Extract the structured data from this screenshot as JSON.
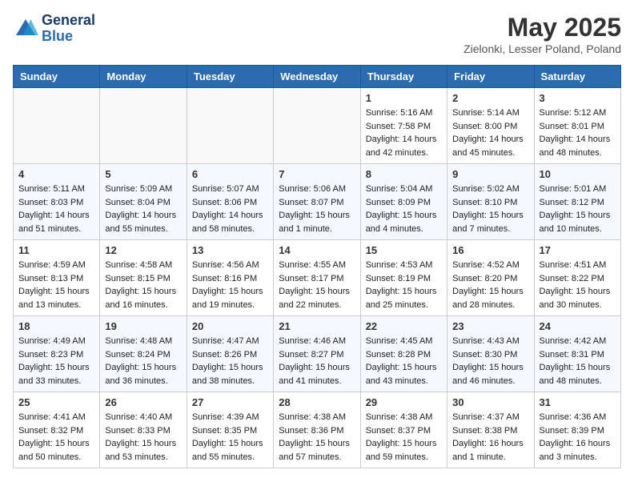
{
  "header": {
    "logo_line1": "General",
    "logo_line2": "Blue",
    "month": "May 2025",
    "location": "Zielonki, Lesser Poland, Poland"
  },
  "weekdays": [
    "Sunday",
    "Monday",
    "Tuesday",
    "Wednesday",
    "Thursday",
    "Friday",
    "Saturday"
  ],
  "weeks": [
    [
      {
        "day": "",
        "info": ""
      },
      {
        "day": "",
        "info": ""
      },
      {
        "day": "",
        "info": ""
      },
      {
        "day": "",
        "info": ""
      },
      {
        "day": "1",
        "info": "Sunrise: 5:16 AM\nSunset: 7:58 PM\nDaylight: 14 hours\nand 42 minutes."
      },
      {
        "day": "2",
        "info": "Sunrise: 5:14 AM\nSunset: 8:00 PM\nDaylight: 14 hours\nand 45 minutes."
      },
      {
        "day": "3",
        "info": "Sunrise: 5:12 AM\nSunset: 8:01 PM\nDaylight: 14 hours\nand 48 minutes."
      }
    ],
    [
      {
        "day": "4",
        "info": "Sunrise: 5:11 AM\nSunset: 8:03 PM\nDaylight: 14 hours\nand 51 minutes."
      },
      {
        "day": "5",
        "info": "Sunrise: 5:09 AM\nSunset: 8:04 PM\nDaylight: 14 hours\nand 55 minutes."
      },
      {
        "day": "6",
        "info": "Sunrise: 5:07 AM\nSunset: 8:06 PM\nDaylight: 14 hours\nand 58 minutes."
      },
      {
        "day": "7",
        "info": "Sunrise: 5:06 AM\nSunset: 8:07 PM\nDaylight: 15 hours\nand 1 minute."
      },
      {
        "day": "8",
        "info": "Sunrise: 5:04 AM\nSunset: 8:09 PM\nDaylight: 15 hours\nand 4 minutes."
      },
      {
        "day": "9",
        "info": "Sunrise: 5:02 AM\nSunset: 8:10 PM\nDaylight: 15 hours\nand 7 minutes."
      },
      {
        "day": "10",
        "info": "Sunrise: 5:01 AM\nSunset: 8:12 PM\nDaylight: 15 hours\nand 10 minutes."
      }
    ],
    [
      {
        "day": "11",
        "info": "Sunrise: 4:59 AM\nSunset: 8:13 PM\nDaylight: 15 hours\nand 13 minutes."
      },
      {
        "day": "12",
        "info": "Sunrise: 4:58 AM\nSunset: 8:15 PM\nDaylight: 15 hours\nand 16 minutes."
      },
      {
        "day": "13",
        "info": "Sunrise: 4:56 AM\nSunset: 8:16 PM\nDaylight: 15 hours\nand 19 minutes."
      },
      {
        "day": "14",
        "info": "Sunrise: 4:55 AM\nSunset: 8:17 PM\nDaylight: 15 hours\nand 22 minutes."
      },
      {
        "day": "15",
        "info": "Sunrise: 4:53 AM\nSunset: 8:19 PM\nDaylight: 15 hours\nand 25 minutes."
      },
      {
        "day": "16",
        "info": "Sunrise: 4:52 AM\nSunset: 8:20 PM\nDaylight: 15 hours\nand 28 minutes."
      },
      {
        "day": "17",
        "info": "Sunrise: 4:51 AM\nSunset: 8:22 PM\nDaylight: 15 hours\nand 30 minutes."
      }
    ],
    [
      {
        "day": "18",
        "info": "Sunrise: 4:49 AM\nSunset: 8:23 PM\nDaylight: 15 hours\nand 33 minutes."
      },
      {
        "day": "19",
        "info": "Sunrise: 4:48 AM\nSunset: 8:24 PM\nDaylight: 15 hours\nand 36 minutes."
      },
      {
        "day": "20",
        "info": "Sunrise: 4:47 AM\nSunset: 8:26 PM\nDaylight: 15 hours\nand 38 minutes."
      },
      {
        "day": "21",
        "info": "Sunrise: 4:46 AM\nSunset: 8:27 PM\nDaylight: 15 hours\nand 41 minutes."
      },
      {
        "day": "22",
        "info": "Sunrise: 4:45 AM\nSunset: 8:28 PM\nDaylight: 15 hours\nand 43 minutes."
      },
      {
        "day": "23",
        "info": "Sunrise: 4:43 AM\nSunset: 8:30 PM\nDaylight: 15 hours\nand 46 minutes."
      },
      {
        "day": "24",
        "info": "Sunrise: 4:42 AM\nSunset: 8:31 PM\nDaylight: 15 hours\nand 48 minutes."
      }
    ],
    [
      {
        "day": "25",
        "info": "Sunrise: 4:41 AM\nSunset: 8:32 PM\nDaylight: 15 hours\nand 50 minutes."
      },
      {
        "day": "26",
        "info": "Sunrise: 4:40 AM\nSunset: 8:33 PM\nDaylight: 15 hours\nand 53 minutes."
      },
      {
        "day": "27",
        "info": "Sunrise: 4:39 AM\nSunset: 8:35 PM\nDaylight: 15 hours\nand 55 minutes."
      },
      {
        "day": "28",
        "info": "Sunrise: 4:38 AM\nSunset: 8:36 PM\nDaylight: 15 hours\nand 57 minutes."
      },
      {
        "day": "29",
        "info": "Sunrise: 4:38 AM\nSunset: 8:37 PM\nDaylight: 15 hours\nand 59 minutes."
      },
      {
        "day": "30",
        "info": "Sunrise: 4:37 AM\nSunset: 8:38 PM\nDaylight: 16 hours\nand 1 minute."
      },
      {
        "day": "31",
        "info": "Sunrise: 4:36 AM\nSunset: 8:39 PM\nDaylight: 16 hours\nand 3 minutes."
      }
    ]
  ]
}
